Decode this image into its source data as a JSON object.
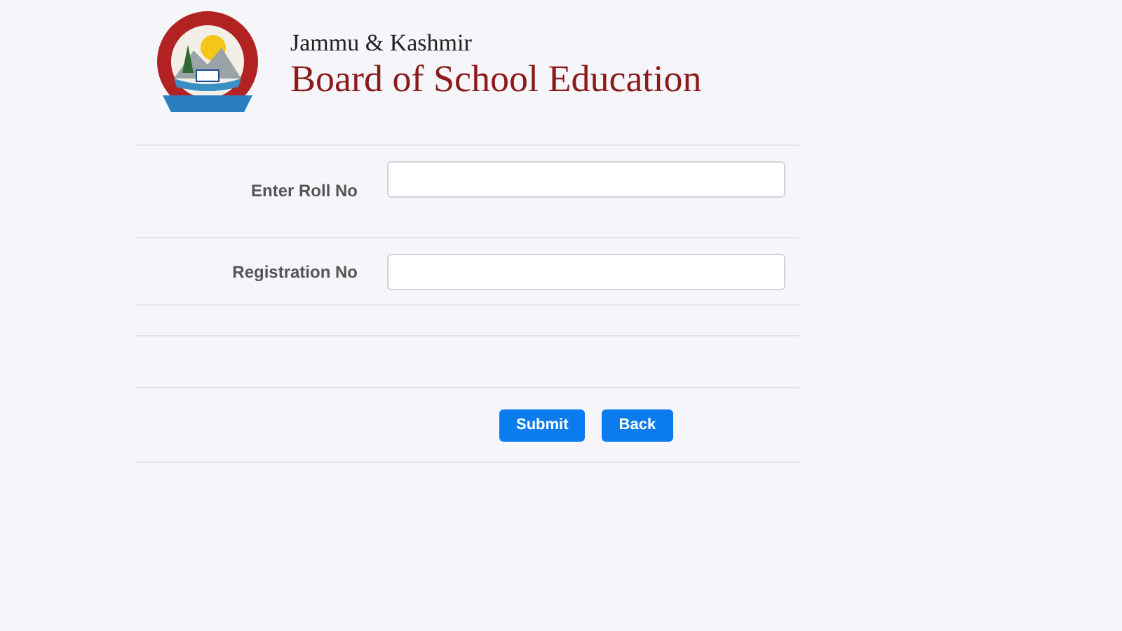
{
  "header": {
    "subtitle": "Jammu & Kashmir",
    "title": "Board of School Education"
  },
  "fields": [
    {
      "label": "Enter Roll No"
    },
    {
      "label": "Registration No"
    }
  ],
  "buttons": [
    "Submit",
    "Back"
  ]
}
